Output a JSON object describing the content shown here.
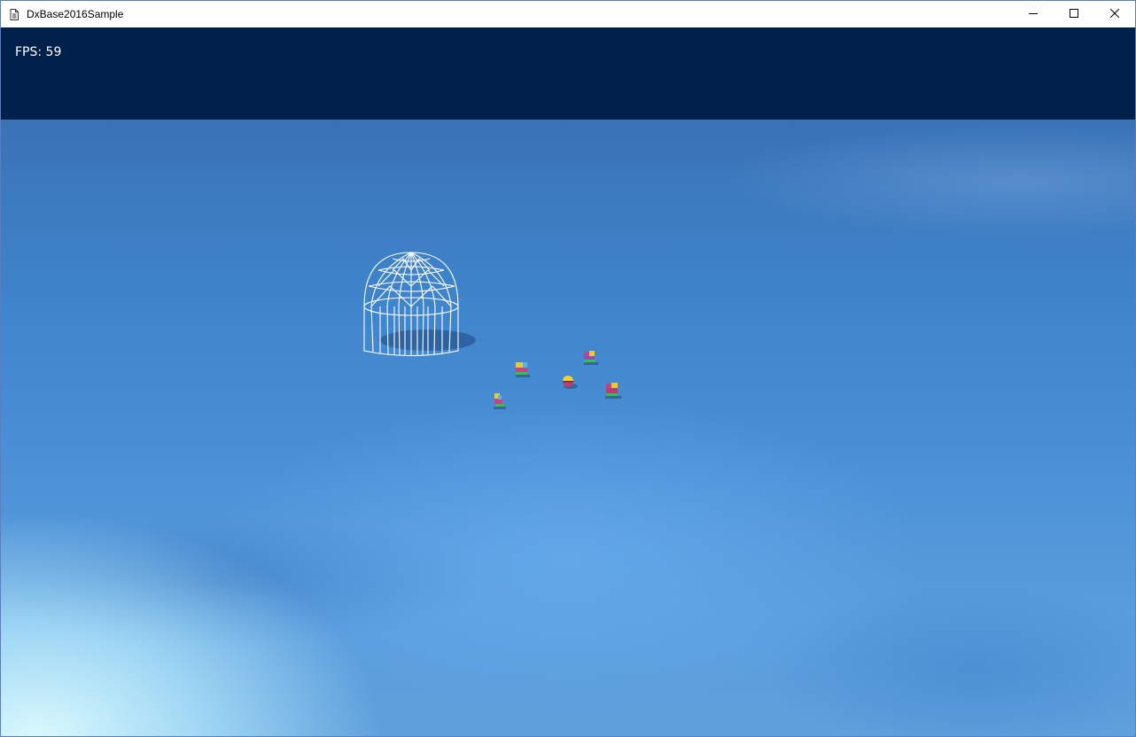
{
  "window": {
    "title": "DxBase2016Sample",
    "icon": "app-document-icon",
    "controls": [
      "minimize-icon",
      "maximize-icon",
      "close-icon"
    ]
  },
  "hud": {
    "fps_text": "FPS: 59"
  },
  "scene": {
    "sky_color": "#00204c",
    "ground_color": "#4a8fd5",
    "wireframe_color": "#ffffff",
    "entities": [
      "robot-character",
      "robot-character",
      "robot-character",
      "robot-character",
      "ball-character"
    ]
  }
}
